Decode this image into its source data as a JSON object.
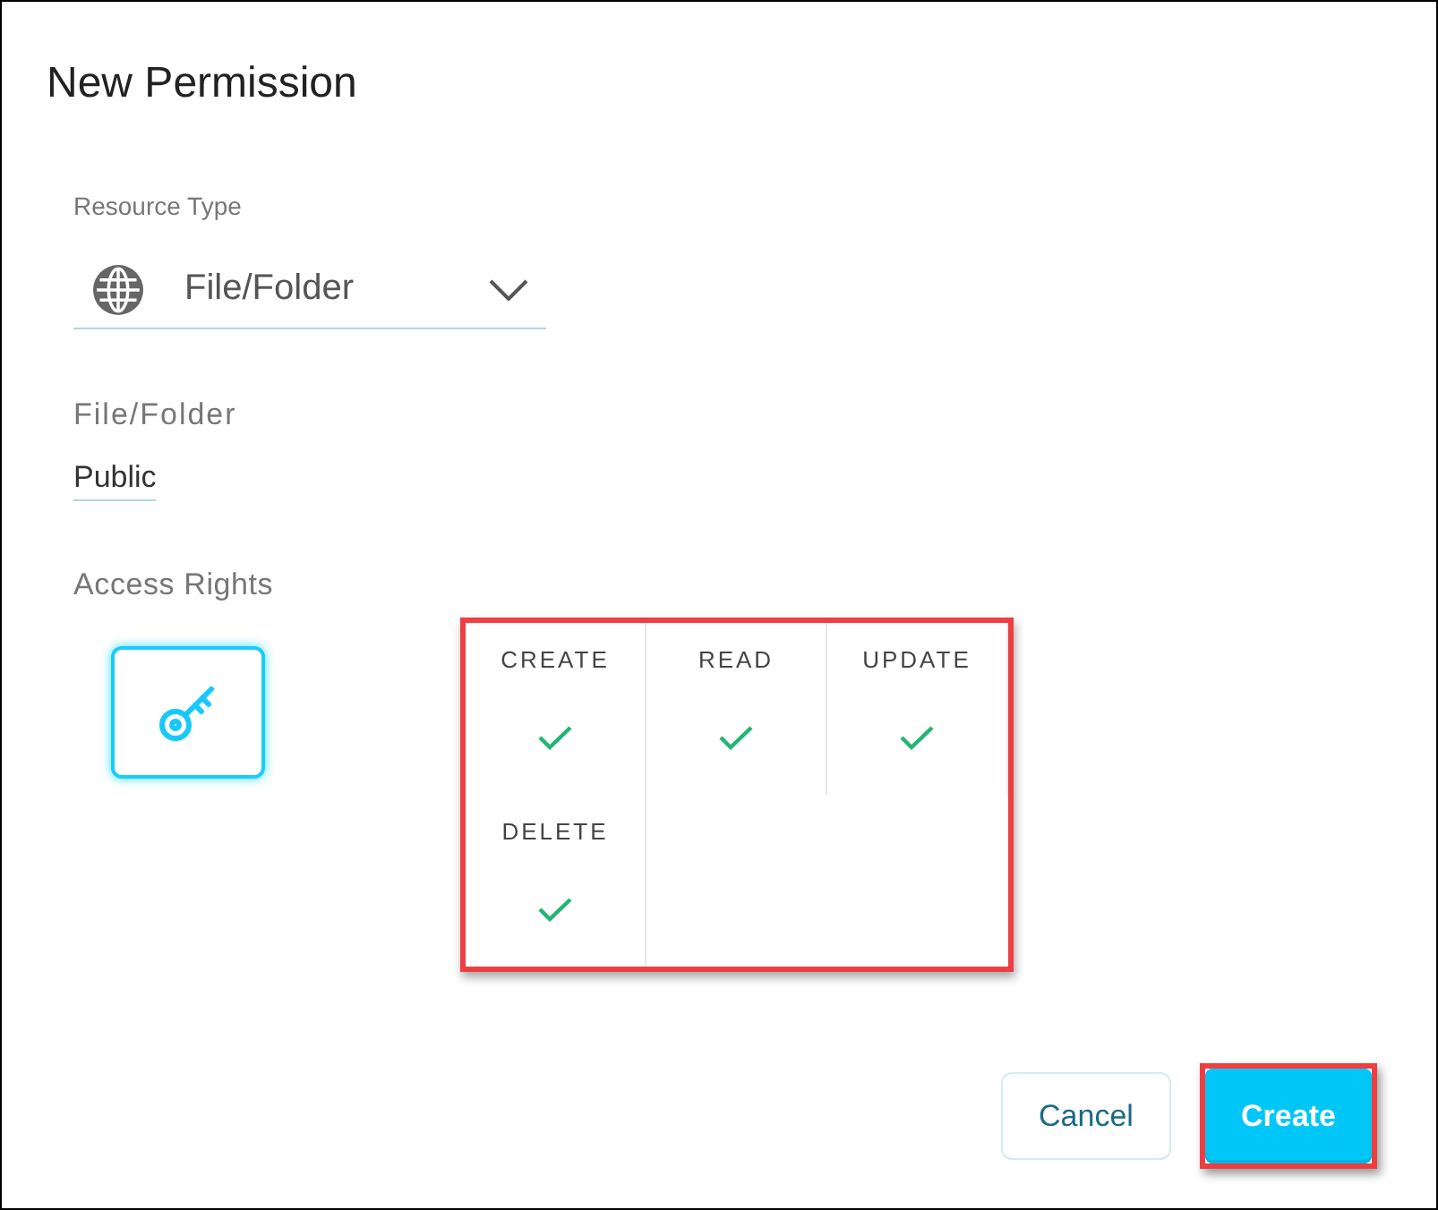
{
  "dialog": {
    "title": "New Permission"
  },
  "resource_type": {
    "label": "Resource Type",
    "value": "File/Folder"
  },
  "file_folder": {
    "label": "File/Folder",
    "value": "Public"
  },
  "access_rights": {
    "label": "Access Rights",
    "key_button": {
      "selected": true
    },
    "highlighted": true,
    "rights": [
      {
        "label": "CREATE",
        "checked": true
      },
      {
        "label": "READ",
        "checked": true
      },
      {
        "label": "UPDATE",
        "checked": true
      },
      {
        "label": "DELETE",
        "checked": true
      }
    ]
  },
  "buttons": [
    {
      "label": "Cancel",
      "kind": "secondary",
      "highlighted": false
    },
    {
      "label": "Create",
      "kind": "primary",
      "highlighted": true
    }
  ]
}
